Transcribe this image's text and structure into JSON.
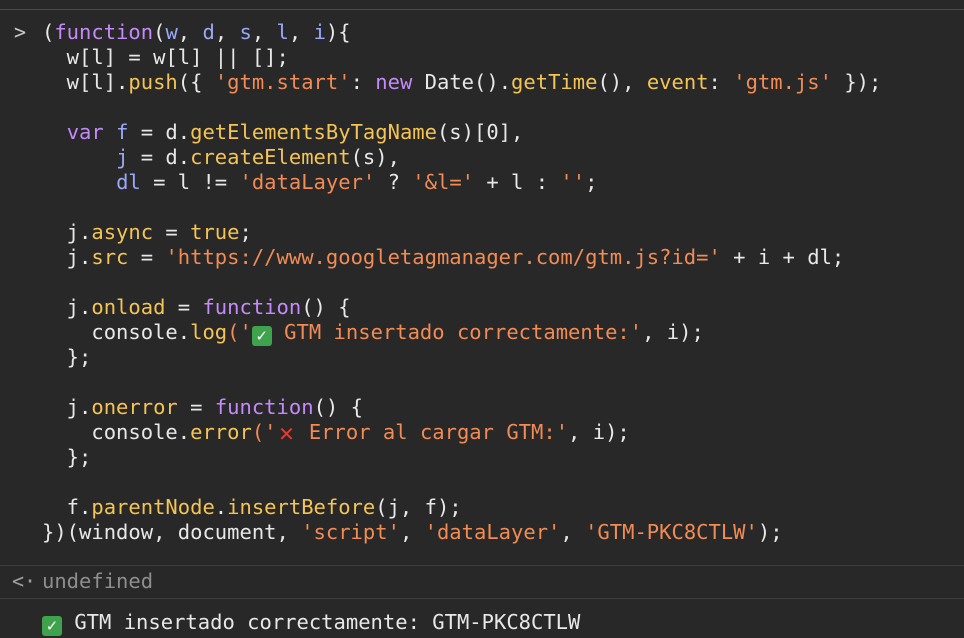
{
  "console": {
    "prompt_symbol": ">",
    "result_symbol": "<·",
    "code": {
      "l1": [
        "(",
        "function",
        "(",
        "w",
        ", ",
        "d",
        ", ",
        "s",
        ", ",
        "l",
        ", ",
        "i",
        "){"
      ],
      "l2": "  w[l] = w[l] || [];",
      "l3": [
        "  w[l].",
        "push",
        "({ ",
        "'gtm.start'",
        ": ",
        "new",
        " Date().",
        "getTime",
        "(), ",
        "event",
        ": ",
        "'gtm.js'",
        " });"
      ],
      "l5": [
        "  ",
        "var",
        " ",
        "f",
        " = d.",
        "getElementsByTagName",
        "(s)[0],"
      ],
      "l6": [
        "      ",
        "j",
        " = d.",
        "createElement",
        "(s),"
      ],
      "l7": [
        "      ",
        "dl",
        " = l != ",
        "'dataLayer'",
        " ? ",
        "'&l='",
        " + l : ",
        "''",
        ";"
      ],
      "l9": [
        "  j.",
        "async",
        " = ",
        "true",
        ";"
      ],
      "l10": [
        "  j.",
        "src",
        " = ",
        "'https://www.googletagmanager.com/gtm.js?id='",
        " + i + dl;"
      ],
      "l12": [
        "  j.",
        "onload",
        " = ",
        "function",
        "() {"
      ],
      "l13": [
        "    console.",
        "log",
        "('",
        "GTM insertado correctamente:'",
        ", i);"
      ],
      "l14": "  };",
      "l16": [
        "  j.",
        "onerror",
        " = ",
        "function",
        "() {"
      ],
      "l17": [
        "    console.",
        "error",
        "('",
        "Error al cargar GTM:'",
        ", i);"
      ],
      "l18": "  };",
      "l20": [
        "  f.",
        "parentNode",
        ".",
        "insertBefore",
        "(j, f);"
      ],
      "l21": [
        "})(window, document, ",
        "'script'",
        ", ",
        "'dataLayer'",
        ", ",
        "'GTM-PKC8CTLW'",
        ");"
      ]
    },
    "result": "undefined",
    "log_message": "GTM insertado correctamente: GTM-PKC8CTLW",
    "icons": {
      "check": "check-mark-icon",
      "cross": "cross-mark-icon"
    }
  }
}
